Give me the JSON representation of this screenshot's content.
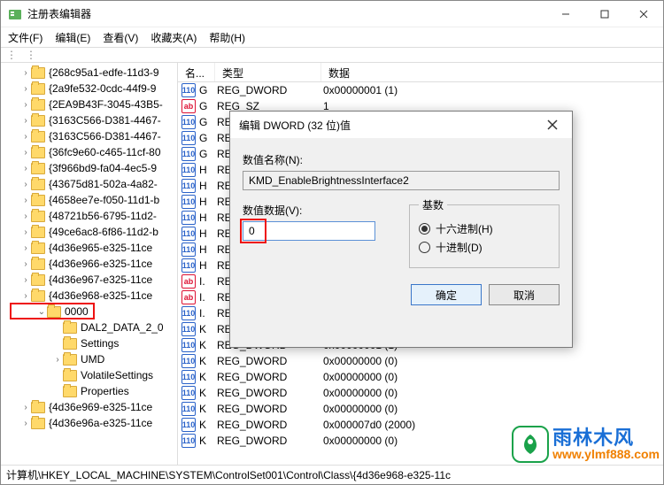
{
  "window": {
    "title": "注册表编辑器"
  },
  "menu": {
    "file": "文件(F)",
    "edit": "编辑(E)",
    "view": "查看(V)",
    "fav": "收藏夹(A)",
    "help": "帮助(H)"
  },
  "tree": {
    "items": [
      "{268c95a1-edfe-11d3-9",
      "{2a9fe532-0cdc-44f9-9",
      "{2EA9B43F-3045-43B5-",
      "{3163C566-D381-4467-",
      "{3163C566-D381-4467-",
      "{36fc9e60-c465-11cf-80",
      "{3f966bd9-fa04-4ec5-9",
      "{43675d81-502a-4a82-",
      "{4658ee7e-f050-11d1-b",
      "{48721b56-6795-11d2-",
      "{49ce6ac8-6f86-11d2-b",
      "{4d36e965-e325-11ce",
      "{4d36e966-e325-11ce",
      "{4d36e967-e325-11ce",
      "{4d36e968-e325-11ce"
    ],
    "selected": "0000",
    "sub": [
      "DAL2_DATA_2_0",
      "Settings",
      "UMD",
      "VolatileSettings",
      "Properties"
    ],
    "after": [
      "{4d36e969-e325-11ce",
      "{4d36e96a-e325-11ce"
    ]
  },
  "list": {
    "headers": {
      "name": "名...",
      "type": "类型",
      "data": "数据"
    },
    "rows": [
      {
        "icon": "dw",
        "n": "G",
        "t": "REG_DWORD",
        "d": "0x00000001 (1)"
      },
      {
        "icon": "sz",
        "n": "G",
        "t": "REG_SZ",
        "d": "1"
      },
      {
        "icon": "dw",
        "n": "G",
        "t": "RE",
        "d": ""
      },
      {
        "icon": "dw",
        "n": "G",
        "t": "RE",
        "d": ""
      },
      {
        "icon": "dw",
        "n": "G",
        "t": "RE",
        "d": ""
      },
      {
        "icon": "dw",
        "n": "H",
        "t": "RE",
        "d": ""
      },
      {
        "icon": "dw",
        "n": "H",
        "t": "RE",
        "d": ""
      },
      {
        "icon": "dw",
        "n": "H",
        "t": "RE",
        "d": ""
      },
      {
        "icon": "dw",
        "n": "H",
        "t": "RE",
        "d": ""
      },
      {
        "icon": "dw",
        "n": "H",
        "t": "RE",
        "d": ""
      },
      {
        "icon": "dw",
        "n": "H",
        "t": "RE",
        "d": ""
      },
      {
        "icon": "dw",
        "n": "H",
        "t": "RE",
        "d": ""
      },
      {
        "icon": "sz",
        "n": "I.",
        "t": "RE",
        "d": ""
      },
      {
        "icon": "sz",
        "n": "I.",
        "t": "RE",
        "d": ""
      },
      {
        "icon": "dw",
        "n": "I.",
        "t": "RE",
        "d": ""
      },
      {
        "icon": "dw",
        "n": "K",
        "t": "REG_DWORD",
        "d": "0x00000000 (0)"
      },
      {
        "icon": "dw",
        "n": "K",
        "t": "REG_DWORD",
        "d": "0x00000001 (1)"
      },
      {
        "icon": "dw",
        "n": "K",
        "t": "REG_DWORD",
        "d": "0x00000000 (0)"
      },
      {
        "icon": "dw",
        "n": "K",
        "t": "REG_DWORD",
        "d": "0x00000000 (0)"
      },
      {
        "icon": "dw",
        "n": "K",
        "t": "REG_DWORD",
        "d": "0x00000000 (0)"
      },
      {
        "icon": "dw",
        "n": "K",
        "t": "REG_DWORD",
        "d": "0x00000000 (0)"
      },
      {
        "icon": "dw",
        "n": "K",
        "t": "REG_DWORD",
        "d": "0x000007d0 (2000)"
      },
      {
        "icon": "dw",
        "n": "K",
        "t": "REG_DWORD",
        "d": "0x00000000 (0)"
      }
    ]
  },
  "dialog": {
    "title": "编辑 DWORD (32 位)值",
    "name_label": "数值名称(N):",
    "name_value": "KMD_EnableBrightnessInterface2",
    "data_label": "数值数据(V):",
    "data_value": "0",
    "base_label": "基数",
    "hex": "十六进制(H)",
    "dec": "十进制(D)",
    "ok": "确定",
    "cancel": "取消"
  },
  "statusbar": "计算机\\HKEY_LOCAL_MACHINE\\SYSTEM\\ControlSet001\\Control\\Class\\{4d36e968-e325-11c",
  "watermark": {
    "cn": "雨林木风",
    "en": "www.ylmf888.com"
  }
}
